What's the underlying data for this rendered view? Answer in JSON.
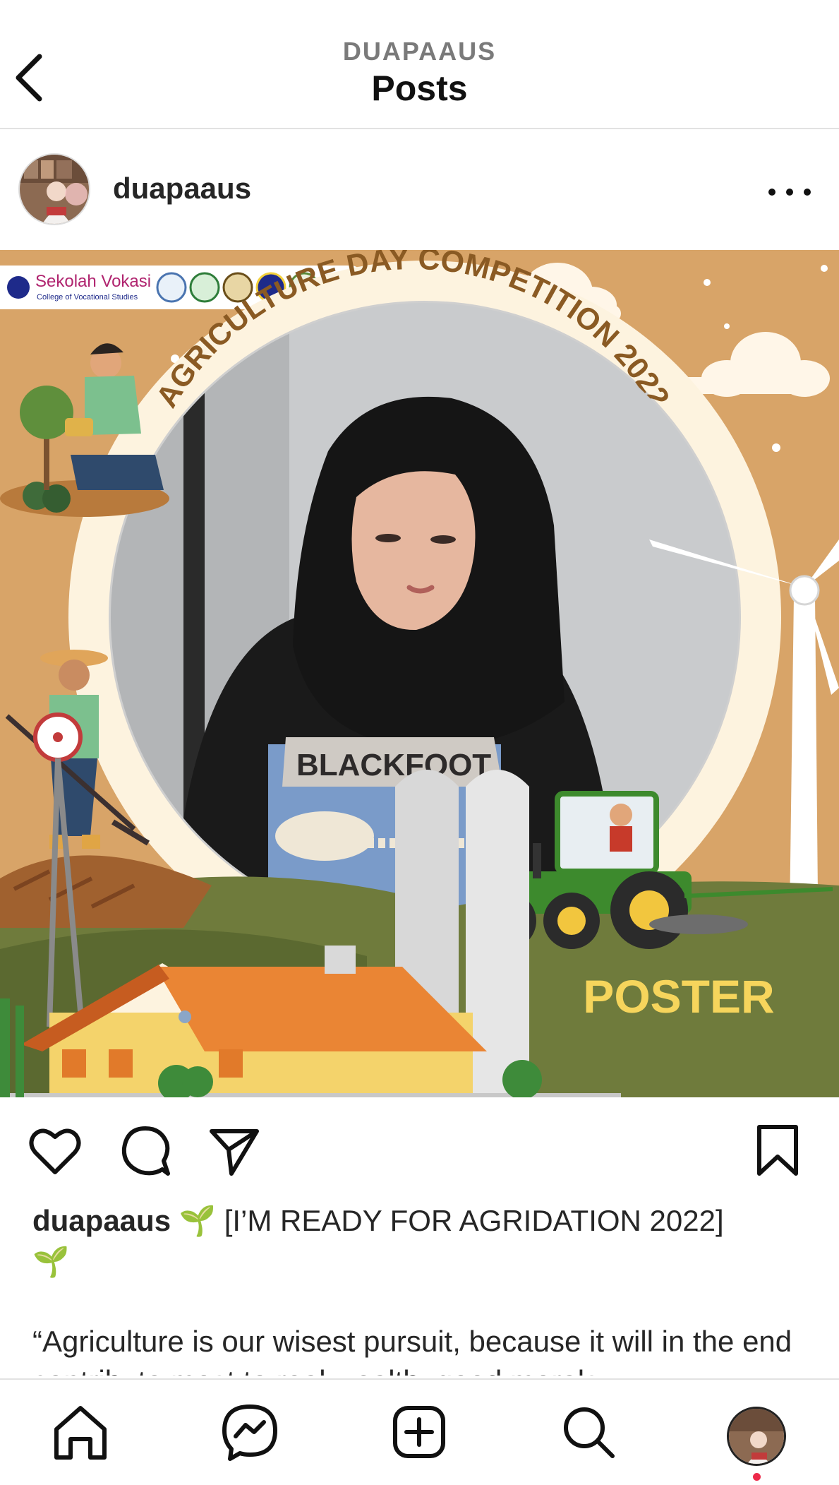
{
  "header": {
    "subtitle": "DUAPAAUS",
    "title": "Posts",
    "back_icon": "chevron-left-icon"
  },
  "post": {
    "username": "duapaaus",
    "more_icon": "more-horizontal-icon",
    "image": {
      "badge_brand": "Sekolah Vokasi",
      "badge_sub": "College of Vocational Studies",
      "arc_title": "AGRICULTURE DAY COMPETITION 2022",
      "poster_label": "POSTER",
      "shirt_text": "BLACKFOOT"
    },
    "actions": [
      "heart-icon",
      "comment-icon",
      "share-icon",
      "bookmark-icon"
    ],
    "caption": {
      "user": "duapaaus",
      "sprout": "🌱",
      "text": "[I’M READY FOR AGRIDATION 2022]",
      "body": "“Agriculture is our wisest pursuit, because it will in the end contribute most to real wealth, good morals"
    }
  },
  "nav": {
    "items": [
      "home-icon",
      "messenger-icon",
      "new-post-icon",
      "search-icon",
      "profile-avatar"
    ]
  },
  "colors": {
    "background": "#ffffff",
    "poster_tan": "#d8a468",
    "arc_text": "#8a5a23",
    "poster_text": "#f6d55c",
    "notification": "#ed2a4a"
  }
}
